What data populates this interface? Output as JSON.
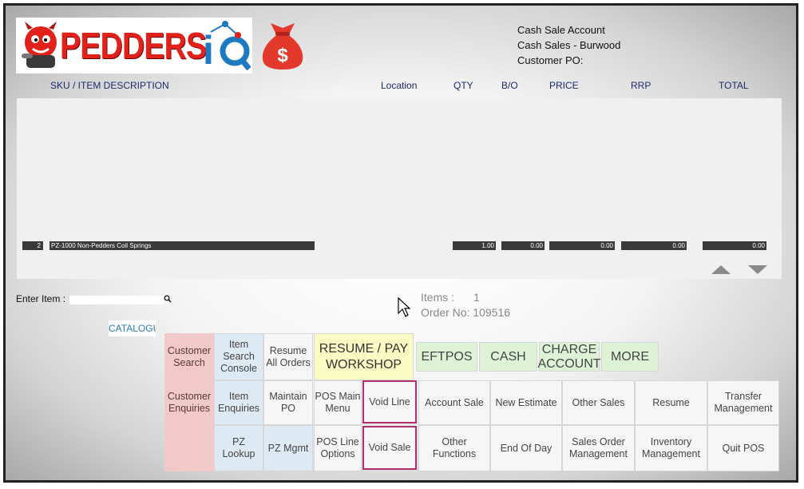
{
  "header": {
    "brand": "PEDDERS",
    "account_lines": [
      "Cash Sale Account",
      "Cash Sales - Burwood",
      "Customer PO:"
    ]
  },
  "columns": {
    "sku": "SKU / ITEM DESCRIPTION",
    "location": "Location",
    "qty": "QTY",
    "bo": "B/O",
    "price": "PRICE",
    "rrp": "RRP",
    "total": "TOTAL"
  },
  "line_item": {
    "num": "2",
    "desc": "PZ-1000 Non-Pedders Coil Springs",
    "qty": "1.00",
    "bo": "0.00",
    "price": "0.00",
    "rrp": "0.00",
    "total": "0.00"
  },
  "entry": {
    "label": "Enter Item :",
    "value": ""
  },
  "summary": {
    "items_label": "Items :",
    "items_count": "1",
    "order_no": "Order No: 109516"
  },
  "catalogue_label": "CATALOGU",
  "buttons": {
    "customer_search": "Customer Search",
    "item_search_console": "Item Search Console",
    "resume_all_orders": "Resume All Orders",
    "resume_pay_workshop": "RESUME / PAY WORKSHOP",
    "eftpos": "EFTPOS",
    "cash": "CASH",
    "charge_account": "CHARGE ACCOUNT",
    "more": "MORE",
    "customer_enquiries": "Customer Enquiries",
    "item_enquiries": "Item Enquiries",
    "maintain_po": "Maintain PO",
    "pos_main_menu": "POS Main Menu",
    "void_line": "Void Line",
    "account_sale": "Account Sale",
    "new_estimate": "New Estimate",
    "other_sales": "Other Sales",
    "resume": "Resume",
    "transfer_management": "Transfer Management",
    "pz_lookup": "PZ Lookup",
    "pz_mgmt": "PZ Mgmt",
    "pos_line_options": "POS Line Options",
    "void_sale": "Void Sale",
    "other_functions": "Other Functions",
    "end_of_day": "End Of Day",
    "sales_order_management": "Sales Order Management",
    "inventory_management": "Inventory Management",
    "quit_pos": "Quit POS"
  },
  "colors": {
    "brand_red": "#e3211b",
    "pink": "#f2c9c9",
    "blue": "#dde9f3",
    "yellow": "#fbfbc4",
    "green": "#def3d6",
    "highlight": "#b0306d"
  }
}
